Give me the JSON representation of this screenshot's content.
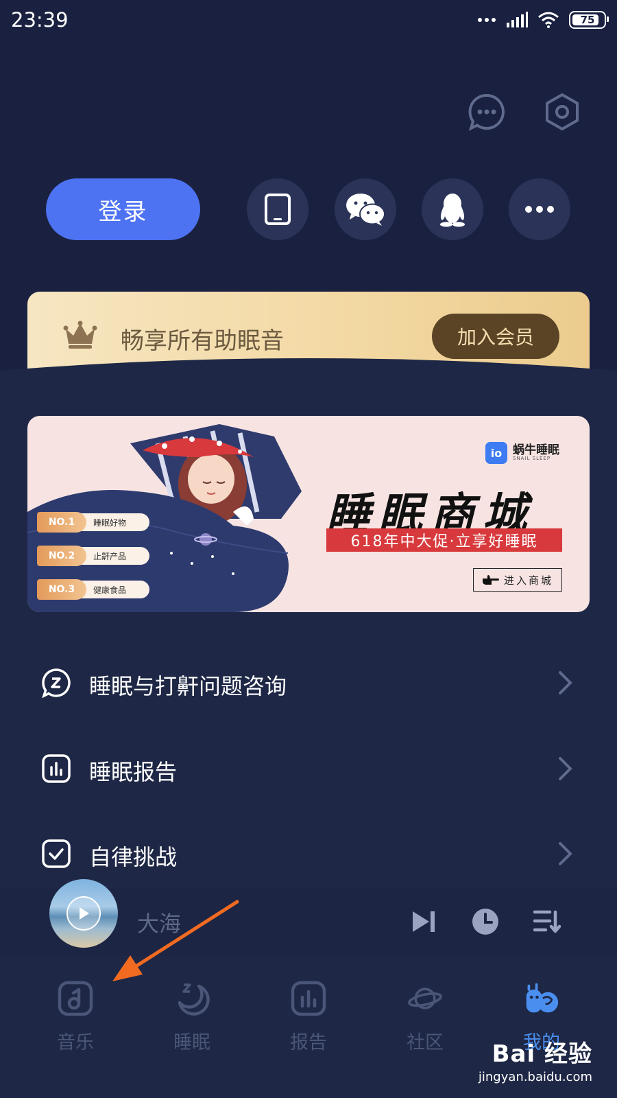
{
  "status_bar": {
    "time": "23:39",
    "battery": "75"
  },
  "account": {
    "login_label": "登录"
  },
  "vip": {
    "text": "畅享所有助眠音",
    "join_label": "加入会员"
  },
  "mall_banner": {
    "brand": "蜗牛睡眠",
    "brand_en": "SNAIL SLEEP",
    "title": "睡眠商城",
    "promo": "618年中大促·立享好睡眠",
    "enter_label": "进入商城",
    "badges": [
      {
        "no": "NO.1",
        "label": "睡眠好物"
      },
      {
        "no": "NO.2",
        "label": "止鼾产品"
      },
      {
        "no": "NO.3",
        "label": "健康食品"
      }
    ]
  },
  "menu": [
    {
      "label": "睡眠与打鼾问题咨询",
      "icon": "chat-z-icon"
    },
    {
      "label": "睡眠报告",
      "icon": "report-icon"
    },
    {
      "label": "自律挑战",
      "icon": "checkbox-icon"
    }
  ],
  "player": {
    "title": "大海"
  },
  "nav": [
    {
      "label": "音乐",
      "icon": "music-icon"
    },
    {
      "label": "睡眠",
      "icon": "moon-icon"
    },
    {
      "label": "报告",
      "icon": "report-icon"
    },
    {
      "label": "社区",
      "icon": "planet-icon"
    },
    {
      "label": "我的",
      "icon": "snail-icon",
      "active": true
    }
  ],
  "watermark": {
    "logo": "Bai 经验",
    "url": "jingyan.baidu.com"
  },
  "colors": {
    "accent": "#4d73f3",
    "background": "#1e2745",
    "vip_gold": "#f3d9a4",
    "promo_red": "#d8393c",
    "annotation_arrow": "#f26b21"
  }
}
